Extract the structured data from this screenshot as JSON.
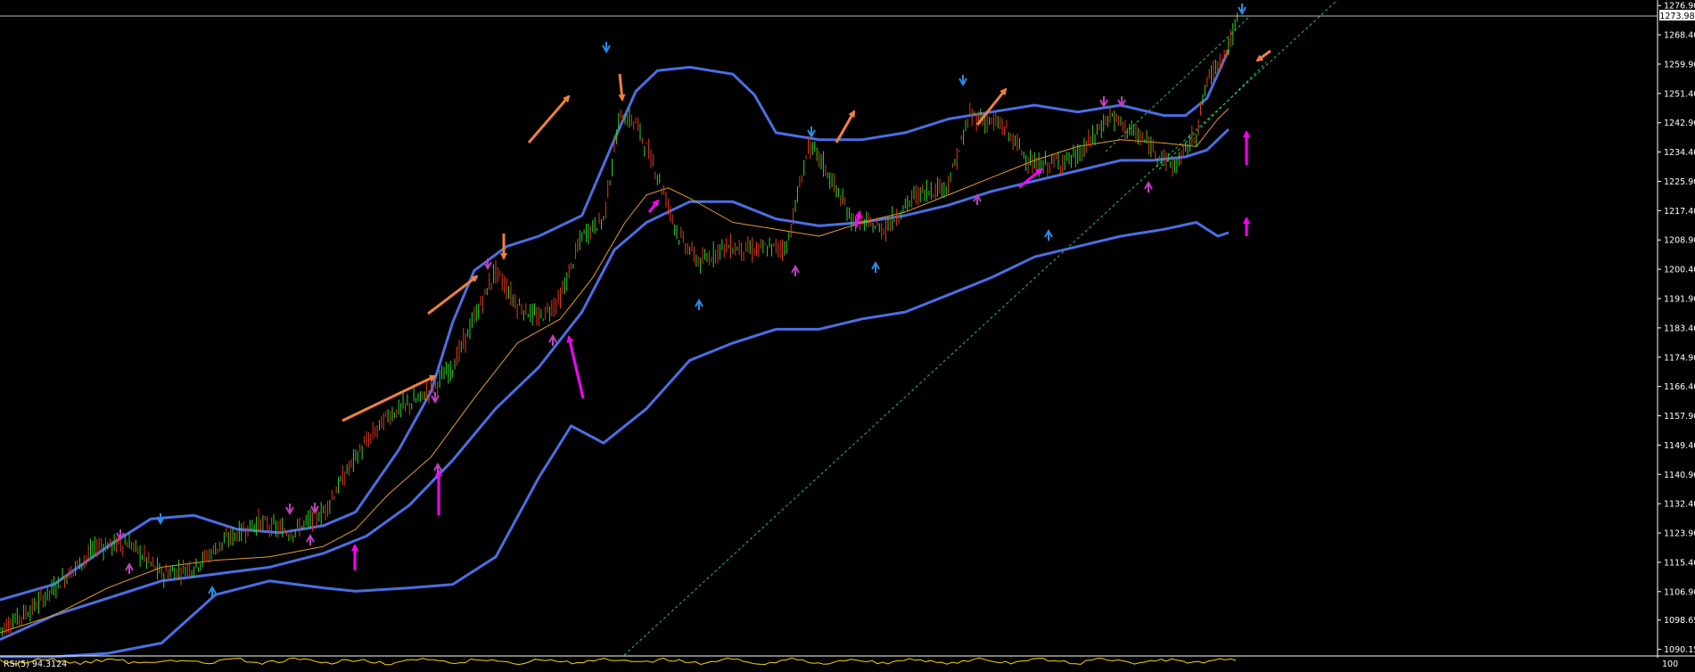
{
  "colors": {
    "background": "#000000",
    "axis_text": "#ffffff",
    "bollinger": "#4a6fe3",
    "moving_average": "#e39b2b",
    "candle_up": "#2ad62a",
    "candle_down": "#e03a1c",
    "trendline": "#23c46b",
    "arrow_orange": "#f08040",
    "arrow_magenta": "#ff00ff",
    "fractal_up": "#2a8be8",
    "fractal_down": "#c040c0",
    "rsi_line": "#ffd400"
  },
  "chart_data": {
    "type": "line",
    "xlabel": "",
    "ylabel": "",
    "grid": false,
    "ylim": [
      1088.5,
      1278.5
    ],
    "y_ticks": [
      "1276.90",
      "1268.40",
      "1259.90",
      "1251.40",
      "1242.90",
      "1234.40",
      "1225.90",
      "1217.40",
      "1208.90",
      "1200.40",
      "1191.90",
      "1183.40",
      "1174.90",
      "1166.40",
      "1157.90",
      "1149.40",
      "1140.90",
      "1132.40",
      "1123.90",
      "1115.40",
      "1106.90",
      "1098.65",
      "1090.15"
    ],
    "current_price_label": "1273.98",
    "current_price": 1273.98,
    "x_count": 1150,
    "series": [
      {
        "role": "price",
        "x": [
          0,
          30,
          60,
          90,
          120,
          150,
          180,
          210,
          240,
          270,
          300,
          330,
          360,
          390,
          420,
          440,
          460,
          480,
          500,
          520,
          540,
          560,
          575,
          590,
          610,
          630,
          650,
          670,
          700,
          730,
          750,
          760,
          790,
          820,
          850,
          880,
          900,
          930,
          960,
          1000,
          1030,
          1060,
          1090,
          1110,
          1120,
          1140,
          1150
        ],
        "values": [
          1096,
          1102,
          1111,
          1120,
          1121,
          1112,
          1114,
          1122,
          1127,
          1124,
          1130,
          1146,
          1158,
          1163,
          1172,
          1186,
          1200,
          1190,
          1186,
          1192,
          1210,
          1215,
          1245,
          1243,
          1228,
          1210,
          1202,
          1207,
          1206,
          1207,
          1236,
          1233,
          1215,
          1212,
          1222,
          1225,
          1245,
          1242,
          1230,
          1233,
          1245,
          1238,
          1230,
          1240,
          1255,
          1265,
          1274
        ]
      },
      {
        "role": "bollinger-upper",
        "x": [
          0,
          50,
          100,
          140,
          180,
          220,
          260,
          300,
          330,
          370,
          400,
          420,
          440,
          470,
          500,
          540,
          570,
          590,
          610,
          640,
          680,
          700,
          720,
          760,
          800,
          840,
          880,
          920,
          960,
          1000,
          1040,
          1080,
          1100,
          1120,
          1140
        ],
        "values": [
          1104.5,
          1109,
          1120,
          1128,
          1129,
          1125,
          1124,
          1126,
          1130,
          1148,
          1165,
          1185,
          1200,
          1207,
          1210,
          1216,
          1238,
          1252,
          1258,
          1259,
          1257,
          1251,
          1240,
          1238,
          1238,
          1240,
          1244,
          1246,
          1248,
          1246,
          1248,
          1245,
          1245,
          1250,
          1264
        ]
      },
      {
        "role": "bollinger-middle",
        "x": [
          0,
          50,
          100,
          150,
          200,
          250,
          300,
          340,
          380,
          420,
          460,
          500,
          540,
          570,
          600,
          640,
          680,
          720,
          760,
          800,
          840,
          880,
          920,
          960,
          1000,
          1040,
          1070,
          1100,
          1120,
          1140
        ],
        "values": [
          1093,
          1100,
          1105,
          1110,
          1112,
          1114,
          1118,
          1123,
          1132,
          1145,
          1160,
          1172,
          1188,
          1206,
          1214,
          1220,
          1220,
          1215,
          1213,
          1214,
          1216,
          1219,
          1223,
          1226,
          1229,
          1232,
          1232,
          1233,
          1235,
          1241
        ]
      },
      {
        "role": "bollinger-lower",
        "x": [
          0,
          50,
          100,
          150,
          200,
          250,
          300,
          330,
          380,
          420,
          460,
          500,
          530,
          560,
          600,
          640,
          680,
          720,
          760,
          800,
          840,
          880,
          920,
          960,
          1000,
          1040,
          1080,
          1110,
          1120,
          1130,
          1140
        ],
        "values": [
          1088,
          1088,
          1089,
          1092,
          1106,
          1110,
          1108,
          1107,
          1108,
          1109,
          1117,
          1140,
          1155,
          1150,
          1160,
          1174,
          1179,
          1183,
          1183,
          1186,
          1188,
          1193,
          1198,
          1204,
          1207,
          1210,
          1212,
          1214,
          1212,
          1210,
          1211
        ]
      },
      {
        "role": "moving-average",
        "x": [
          0,
          50,
          100,
          150,
          200,
          250,
          300,
          330,
          360,
          400,
          440,
          480,
          520,
          550,
          580,
          600,
          620,
          640,
          680,
          720,
          760,
          800,
          840,
          880,
          920,
          960,
          1000,
          1040,
          1080,
          1110,
          1130,
          1140
        ],
        "values": [
          1095,
          1100,
          1108,
          1114,
          1116,
          1117,
          1120,
          1125,
          1135,
          1146,
          1163,
          1179,
          1186,
          1198,
          1214,
          1222,
          1224,
          1221,
          1214,
          1212,
          1210,
          1214,
          1217,
          1222,
          1227,
          1232,
          1236,
          1238,
          1237,
          1236,
          1244,
          1247
        ]
      }
    ],
    "rsi": {
      "label": "RSI(5) 94.3124",
      "scale_top": "100",
      "value": 94.3124
    }
  }
}
